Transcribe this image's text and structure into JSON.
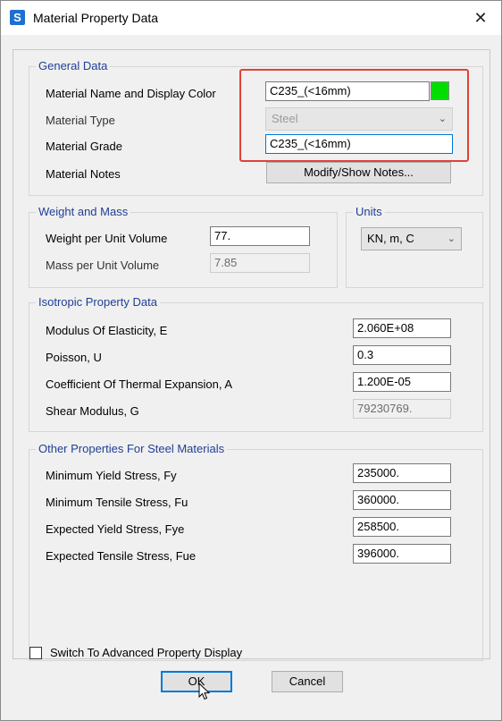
{
  "window": {
    "icon_letter": "S",
    "title": "Material Property Data",
    "close_glyph": "✕"
  },
  "general": {
    "title": "General Data",
    "name_label": "Material Name and Display Color",
    "name_value": "C235_(<16mm)",
    "display_color": "#00dd00",
    "type_label": "Material Type",
    "type_value": "Steel",
    "grade_label": "Material Grade",
    "grade_value": "C235_(<16mm)",
    "notes_label": "Material Notes",
    "notes_button": "Modify/Show Notes..."
  },
  "weight": {
    "title": "Weight and Mass",
    "weight_label": "Weight per Unit Volume",
    "weight_value": "77.",
    "mass_label": "Mass per Unit Volume",
    "mass_value": "7.85"
  },
  "units": {
    "title": "Units",
    "value": "KN, m, C"
  },
  "isotropic": {
    "title": "Isotropic Property Data",
    "rows": [
      {
        "label": "Modulus Of Elasticity,  E",
        "value": "2.060E+08"
      },
      {
        "label": "Poisson,  U",
        "value": "0.3"
      },
      {
        "label": "Coefficient Of Thermal Expansion,  A",
        "value": "1.200E-05"
      },
      {
        "label": "Shear Modulus,  G",
        "value": "79230769."
      }
    ]
  },
  "steel": {
    "title": "Other Properties For Steel Materials",
    "rows": [
      {
        "label": "Minimum Yield Stress, Fy",
        "value": "235000."
      },
      {
        "label": "Minimum Tensile Stress, Fu",
        "value": "360000."
      },
      {
        "label": "Expected Yield Stress, Fye",
        "value": "258500."
      },
      {
        "label": "Expected Tensile Stress, Fue",
        "value": "396000."
      }
    ]
  },
  "advanced_label": "Switch To Advanced Property Display",
  "ok_label": "OK",
  "cancel_label": "Cancel"
}
